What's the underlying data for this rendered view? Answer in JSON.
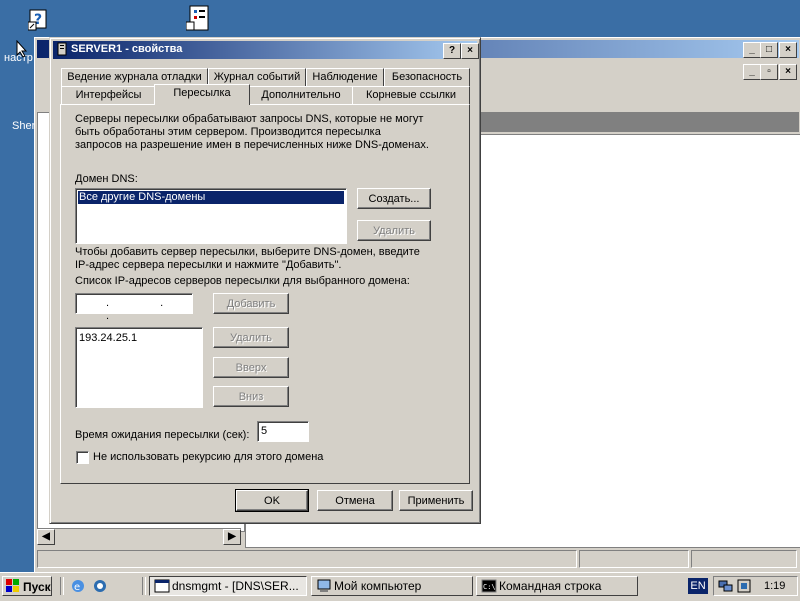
{
  "desktop": {
    "icon1_label_fragment": "настр",
    "icon2_label_fragment": "Sher"
  },
  "dialog": {
    "title": "SERVER1 - свойства",
    "help_btn": "?",
    "close_btn": "×",
    "tabs_row1": [
      "Ведение журнала отладки",
      "Журнал событий",
      "Наблюдение",
      "Безопасность"
    ],
    "tabs_row2": [
      "Интерфейсы",
      "Пересылка",
      "Дополнительно",
      "Корневые ссылки"
    ],
    "active_tab": "Пересылка",
    "description": [
      "Серверы пересылки обрабатывают запросы DNS, которые не могут",
      "быть обработаны этим сервером. Производится пересылка",
      "запросов на разрешение имен в перечисленных ниже DNS-доменах."
    ],
    "dns_domain_label": "Домен DNS:",
    "dns_domains": [
      "Все другие DNS-домены"
    ],
    "create_btn": "Создать...",
    "delete_btn1": "Удалить",
    "instructions": [
      "Чтобы добавить сервер пересылки, выберите DNS-домен, введите",
      "IP-адрес сервера пересылки и нажмите \"Добавить\"."
    ],
    "ip_list_label": "Список IP-адресов серверов пересылки для выбранного домена:",
    "ip_input_value": ". . .",
    "add_btn": "Добавить",
    "ip_list": [
      "193.24.25.1"
    ],
    "delete_btn2": "Удалить",
    "up_btn": "Вверх",
    "down_btn": "Вниз",
    "timeout_label": "Время ожидания пересылки (сек):",
    "timeout_value": "5",
    "no_recursion_label": "Не использовать рекурсию для этого домена",
    "no_recursion_checked": false,
    "ok_btn": "OK",
    "cancel_btn": "Отмена",
    "apply_btn": "Применить"
  },
  "taskbar": {
    "start_label": "Пуск",
    "tasks": [
      "dnsmgmt - [DNS\\SER...",
      "Мой компьютер",
      "Командная строка"
    ],
    "language": "EN",
    "clock": "1:19"
  },
  "colors": {
    "desktop": "#3a6ea5",
    "titlebar_active": "#0a246a",
    "face": "#d4d0c8"
  }
}
